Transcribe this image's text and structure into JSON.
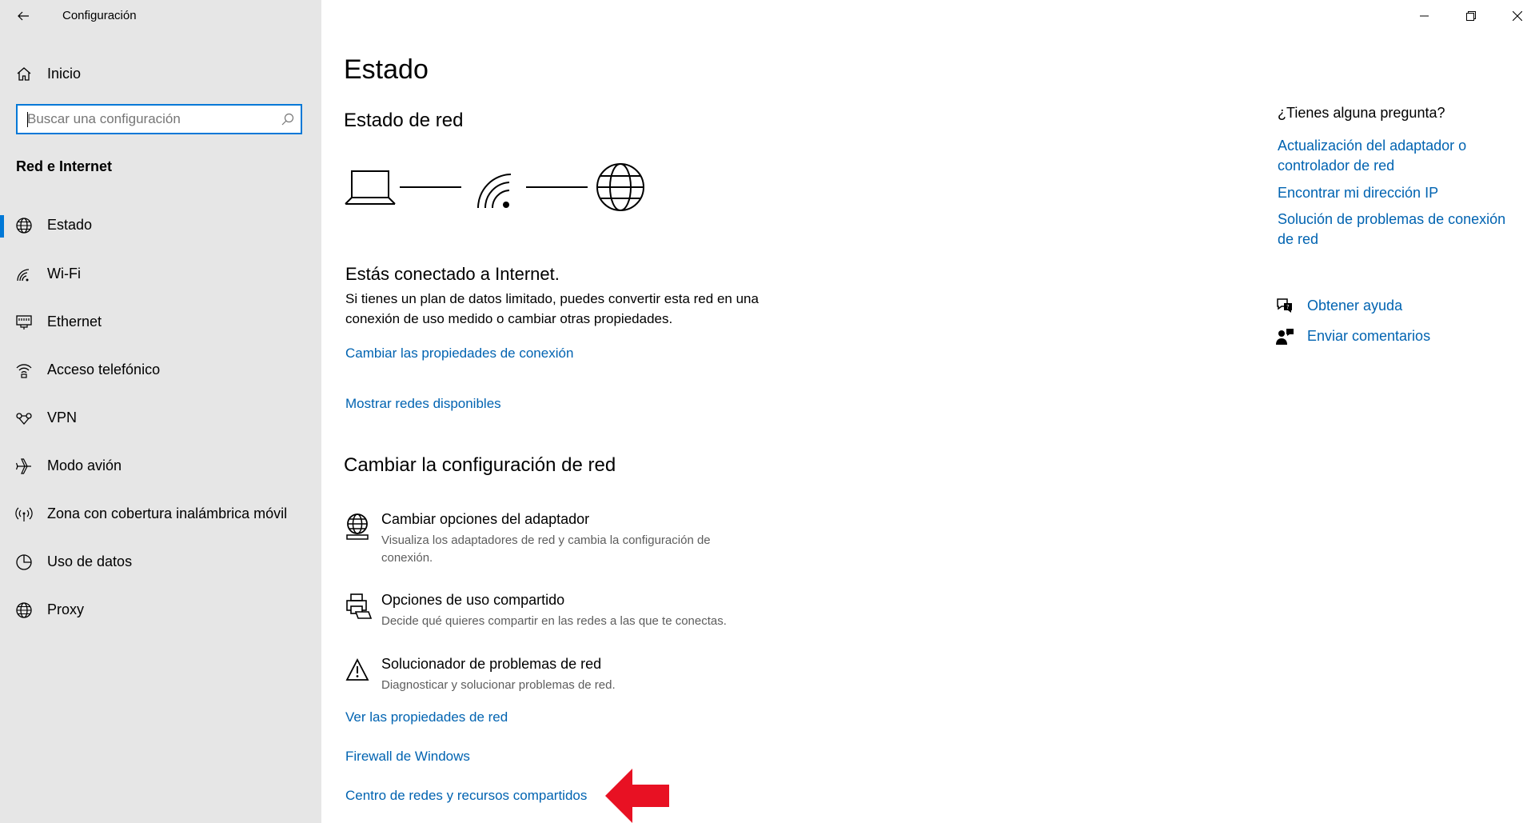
{
  "window": {
    "title": "Configuración",
    "back_icon": "back-arrow-icon",
    "controls": [
      "minimize-icon",
      "restore-icon",
      "close-icon"
    ]
  },
  "sidebar": {
    "home_label": "Inicio",
    "search": {
      "placeholder": "Buscar una configuración",
      "value": ""
    },
    "section_title": "Red e Internet",
    "items": [
      {
        "label": "Estado",
        "icon": "globe-status-icon",
        "active": true
      },
      {
        "label": "Wi-Fi",
        "icon": "wifi-icon",
        "active": false
      },
      {
        "label": "Ethernet",
        "icon": "ethernet-icon",
        "active": false
      },
      {
        "label": "Acceso telefónico",
        "icon": "dialup-icon",
        "active": false
      },
      {
        "label": "VPN",
        "icon": "vpn-icon",
        "active": false
      },
      {
        "label": "Modo avión",
        "icon": "airplane-icon",
        "active": false
      },
      {
        "label": "Zona con cobertura inalámbrica móvil",
        "icon": "hotspot-icon",
        "active": false
      },
      {
        "label": "Uso de datos",
        "icon": "data-usage-icon",
        "active": false
      },
      {
        "label": "Proxy",
        "icon": "globe-icon",
        "active": false
      }
    ]
  },
  "main": {
    "page_title": "Estado",
    "network_status_title": "Estado de red",
    "diagram_icons": [
      "laptop-icon",
      "wifi-signal-icon",
      "globe-icon"
    ],
    "connected_heading": "Estás conectado a Internet.",
    "connected_desc": "Si tienes un plan de datos limitado, puedes convertir esta red en una conexión de uso medido o cambiar otras propiedades.",
    "change_conn_props_link": "Cambiar las propiedades de conexión",
    "show_networks_link": "Mostrar redes disponibles",
    "change_settings_title": "Cambiar la configuración de red",
    "options": [
      {
        "title": "Cambiar opciones del adaptador",
        "desc": "Visualiza los adaptadores de red y cambia la configuración de conexión.",
        "icon": "adapter-globe-icon"
      },
      {
        "title": "Opciones de uso compartido",
        "desc": "Decide qué quieres compartir en las redes a las que te conectas.",
        "icon": "sharing-printer-icon"
      },
      {
        "title": "Solucionador de problemas de red",
        "desc": "Diagnosticar y solucionar problemas de red.",
        "icon": "warning-triangle-icon"
      }
    ],
    "view_props_link": "Ver las propiedades de red",
    "firewall_link": "Firewall de Windows",
    "network_center_link": "Centro de redes y recursos compartidos",
    "annotation": {
      "icon": "red-arrow-icon",
      "color": "#e81123"
    }
  },
  "help": {
    "question": "¿Tienes alguna pregunta?",
    "links": [
      "Actualización del adaptador o controlador de red",
      "Encontrar mi dirección IP",
      "Solución de problemas de conexión de red"
    ],
    "get_help": "Obtener ayuda",
    "get_help_icon": "chat-help-icon",
    "feedback": "Enviar comentarios",
    "feedback_icon": "feedback-person-icon"
  },
  "colors": {
    "accent": "#0078d7",
    "link": "#0063b1",
    "sidebar_bg": "#e6e6e6",
    "annotation_red": "#e81123"
  }
}
